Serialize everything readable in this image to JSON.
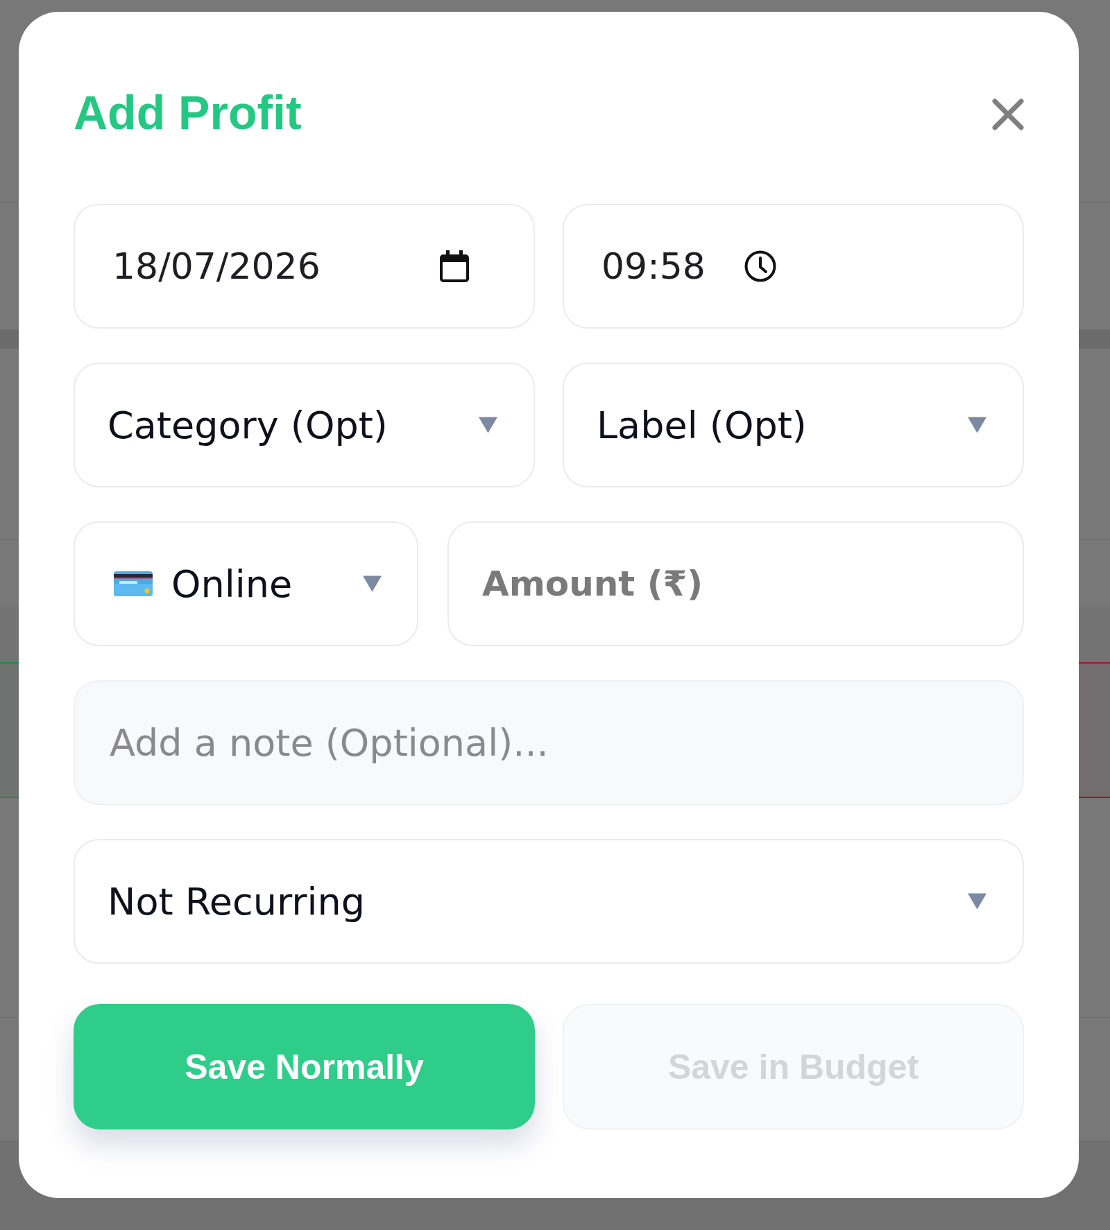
{
  "dialog": {
    "title": "Add Profit"
  },
  "date_field": {
    "value": "18/07/2026"
  },
  "time_field": {
    "value": "09:58"
  },
  "category_select": {
    "value": "Category (Opt)"
  },
  "label_select": {
    "value": "Label (Opt)"
  },
  "payment_select": {
    "value": "Online"
  },
  "amount_field": {
    "placeholder": "Amount (₹)"
  },
  "note_field": {
    "placeholder": "Add a note (Optional)..."
  },
  "recurrence_select": {
    "value": "Not Recurring"
  },
  "buttons": [
    {
      "label": "Save Normally",
      "kind": "primary",
      "disabled": false
    },
    {
      "label": "Save in Budget",
      "kind": "secondary",
      "disabled": true
    }
  ]
}
